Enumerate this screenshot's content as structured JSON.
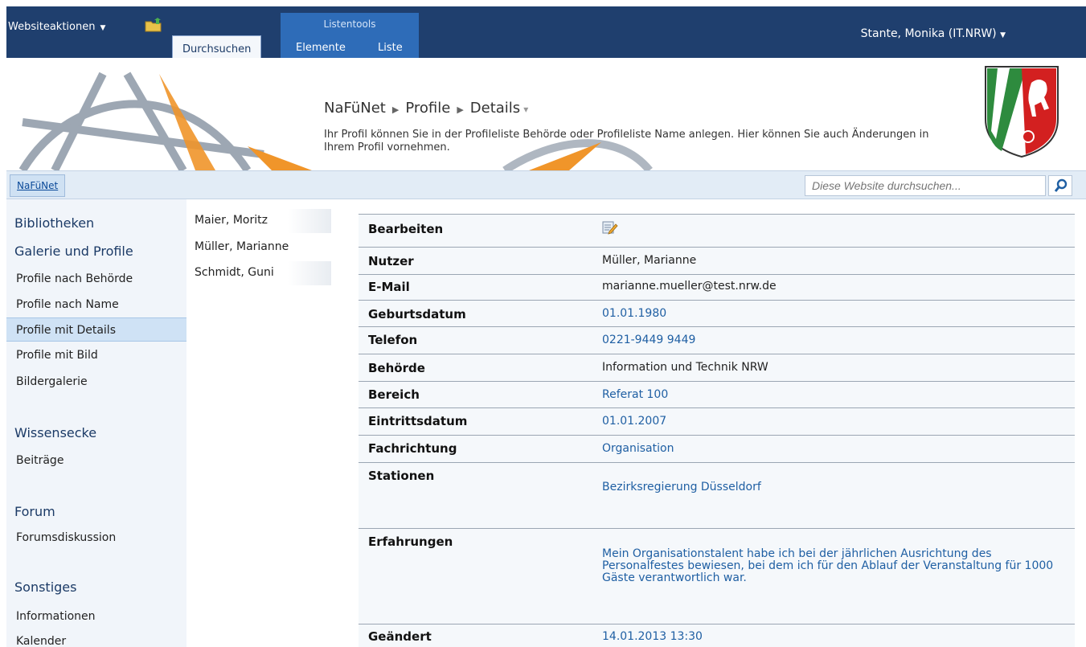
{
  "ribbon": {
    "site_actions": "Websiteaktionen",
    "tab_browse": "Durchsuchen",
    "contextual_group": "Listentools",
    "tab_items": "Elemente",
    "tab_list": "Liste",
    "user": "Stante, Monika (IT.NRW)"
  },
  "breadcrumb": {
    "site": "NaFüNet",
    "list": "Profile",
    "page": "Details"
  },
  "description": "Ihr Profil können Sie in der Profileliste Behörde oder Profileliste Name anlegen. Hier können Sie auch Änderungen in Ihrem Profil vornehmen.",
  "topnav": {
    "home": "NaFüNet",
    "search_placeholder": "Diese Website durchsuchen..."
  },
  "quicklaunch": {
    "h1": "Bibliotheken",
    "h2": "Galerie und Profile",
    "i1": "Profile nach Behörde",
    "i2": "Profile nach Name",
    "i3": "Profile mit Details",
    "i4": "Profile mit Bild",
    "i5": "Bildergalerie",
    "h3": "Wissensecke",
    "i6": "Beiträge",
    "h4": "Forum",
    "i7": "Forumsdiskussion",
    "h5": "Sonstiges",
    "i8": "Informationen",
    "i9": "Kalender"
  },
  "names": [
    "Maier, Moritz",
    "Müller, Marianne",
    "Schmidt, Guni"
  ],
  "details": {
    "edit": "Bearbeiten",
    "user_label": "Nutzer",
    "user": "Müller, Marianne",
    "email_label": "E-Mail",
    "email": "marianne.mueller@test.nrw.de",
    "birth_label": "Geburtsdatum",
    "birth": "01.01.1980",
    "phone_label": "Telefon",
    "phone": "0221-9449 9449",
    "agency_label": "Behörde",
    "agency": "Information und Technik NRW",
    "area_label": "Bereich",
    "area": "Referat 100",
    "entry_label": "Eintrittsdatum",
    "entry": "01.01.2007",
    "field_label": "Fachrichtung",
    "field": "Organisation",
    "stations_label": "Stationen",
    "stations": "Bezirksregierung Düsseldorf",
    "exp_label": "Erfahrungen",
    "exp": "Mein Organisationstalent habe ich bei der jährlichen Ausrichtung des Personalfestes bewiesen, bei dem ich für den Ablauf der Veranstaltung für 1000 Gäste verantwortlich war.",
    "changed_label": "Geändert",
    "changed": "14.01.2013 13:30"
  }
}
